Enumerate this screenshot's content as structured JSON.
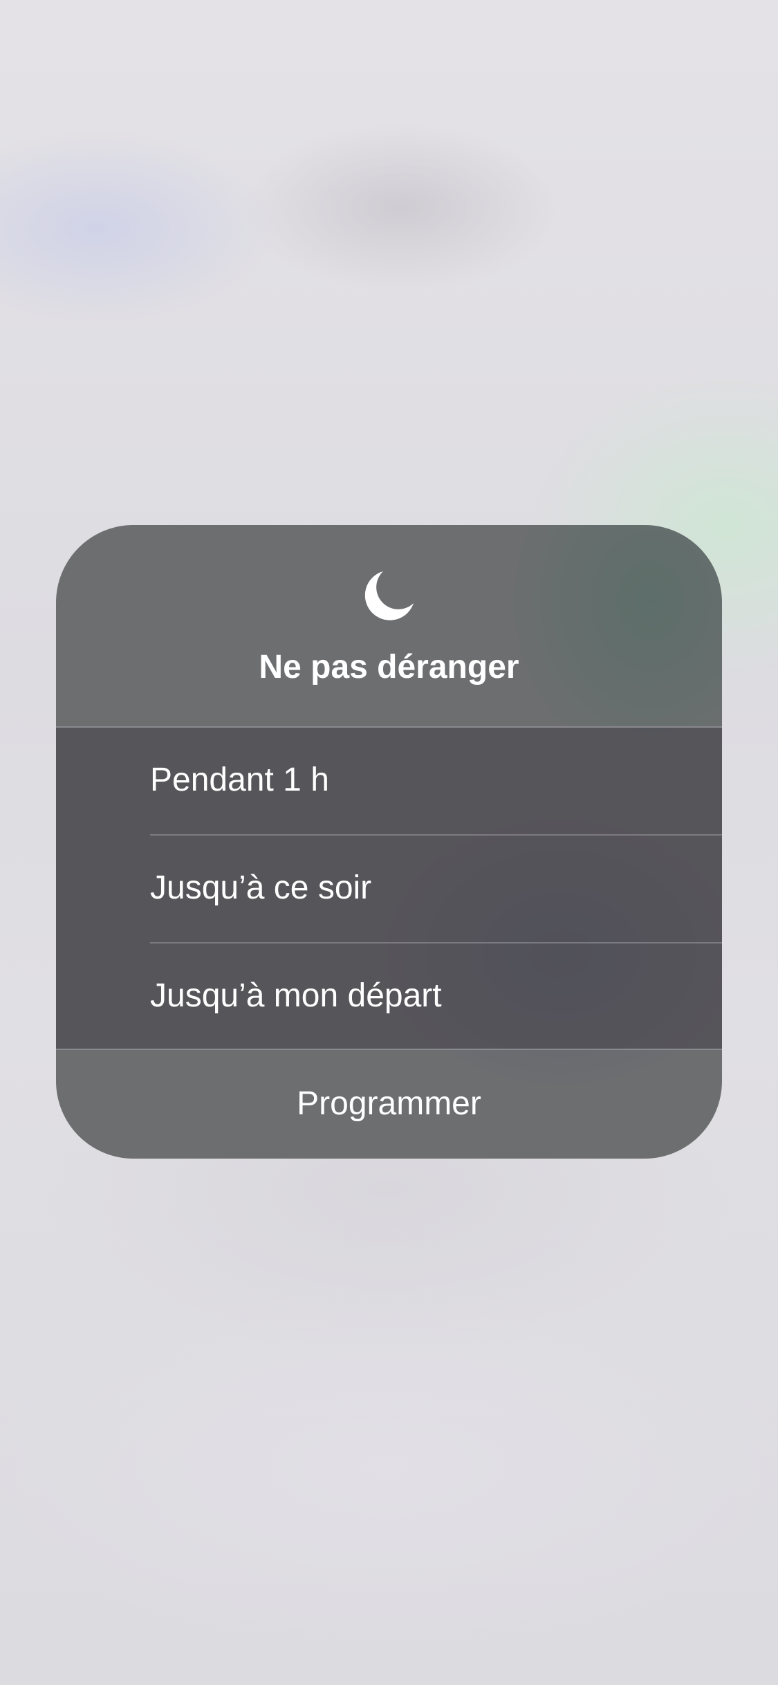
{
  "dnd_menu": {
    "icon": "moon-icon",
    "title": "Ne pas déranger",
    "options": [
      {
        "label": "Pendant 1 h"
      },
      {
        "label": "Jusqu’à ce soir"
      },
      {
        "label": "Jusqu’à mon départ"
      }
    ],
    "schedule_label": "Programmer"
  },
  "colors": {
    "panel": "#6d6e70",
    "menu_section": "#58565e",
    "text": "#ffffff"
  }
}
